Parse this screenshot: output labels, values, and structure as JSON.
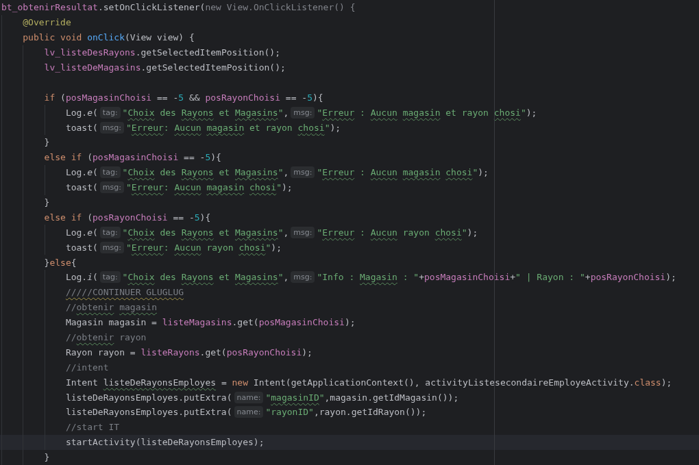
{
  "lines": [
    {
      "current": false,
      "tokens": [
        {
          "text": "bt_obtenirResultat",
          "kind": "field"
        },
        {
          "text": ".setOnClickListener(",
          "kind": "plain"
        },
        {
          "text": "new View.OnClickListener() {",
          "kind": "faded"
        }
      ],
      "children": [
        {
          "current": false,
          "tokens": [
            {
              "text": "@Override",
              "kind": "annotation"
            }
          ]
        },
        {
          "current": false,
          "tokens": [
            {
              "text": "public void ",
              "kind": "keyword"
            },
            {
              "text": "onClick",
              "kind": "method"
            },
            {
              "text": "(View view) {",
              "kind": "plain"
            }
          ],
          "children": [
            {
              "current": false,
              "tokens": [
                {
                  "text": "lv_listeDesRayons",
                  "kind": "field"
                },
                {
                  "text": ".getSelectedItemPosition();",
                  "kind": "plain"
                }
              ]
            },
            {
              "current": false,
              "tokens": [
                {
                  "text": "lv_listeDeMagasins",
                  "kind": "field"
                },
                {
                  "text": ".getSelectedItemPosition();",
                  "kind": "plain"
                }
              ]
            },
            {
              "current": false
            },
            {
              "current": false,
              "tokens": [
                {
                  "text": "if ",
                  "kind": "keyword"
                },
                {
                  "text": "(",
                  "kind": "plain"
                },
                {
                  "text": "posMagasinChoisi",
                  "kind": "field"
                },
                {
                  "text": " == -",
                  "kind": "plain"
                },
                {
                  "text": "5",
                  "kind": "number"
                },
                {
                  "text": " && ",
                  "kind": "plain"
                },
                {
                  "text": "posRayonChoisi",
                  "kind": "field"
                },
                {
                  "text": " == -",
                  "kind": "plain"
                },
                {
                  "text": "5",
                  "kind": "number"
                },
                {
                  "text": "){",
                  "kind": "plain"
                }
              ],
              "children": [
                {
                  "current": false,
                  "tokens": [
                    {
                      "text": "Log.",
                      "kind": "plain"
                    },
                    {
                      "text": "e",
                      "kind": "static"
                    },
                    {
                      "text": "(",
                      "kind": "plain"
                    },
                    {
                      "text": "tag:",
                      "kind": "hint"
                    },
                    {
                      "text": "\"",
                      "kind": "string"
                    },
                    {
                      "text": "Choix",
                      "kind": "string",
                      "misspelled": true
                    },
                    {
                      "text": " des",
                      "kind": "string"
                    },
                    {
                      "text": " Rayons",
                      "kind": "string",
                      "misspelled": true
                    },
                    {
                      "text": " et",
                      "kind": "string"
                    },
                    {
                      "text": " Magasins",
                      "kind": "string",
                      "misspelled": true
                    },
                    {
                      "text": "\"",
                      "kind": "string"
                    },
                    {
                      "text": ",",
                      "kind": "plain"
                    },
                    {
                      "text": "msg:",
                      "kind": "hint"
                    },
                    {
                      "text": "\"",
                      "kind": "string"
                    },
                    {
                      "text": "Erreur",
                      "kind": "string",
                      "misspelled": true
                    },
                    {
                      "text": " :",
                      "kind": "string"
                    },
                    {
                      "text": " Aucun",
                      "kind": "string",
                      "misspelled": true
                    },
                    {
                      "text": " magasin",
                      "kind": "string",
                      "misspelled": true
                    },
                    {
                      "text": " et rayon",
                      "kind": "string"
                    },
                    {
                      "text": " chosi",
                      "kind": "string",
                      "misspelled": true
                    },
                    {
                      "text": "\"",
                      "kind": "string"
                    },
                    {
                      "text": ");",
                      "kind": "plain"
                    }
                  ]
                },
                {
                  "current": false,
                  "tokens": [
                    {
                      "text": "toast(",
                      "kind": "plain"
                    },
                    {
                      "text": "msg:",
                      "kind": "hint"
                    },
                    {
                      "text": "\"",
                      "kind": "string"
                    },
                    {
                      "text": "Erreur",
                      "kind": "string",
                      "misspelled": true
                    },
                    {
                      "text": ":",
                      "kind": "string"
                    },
                    {
                      "text": " Aucun",
                      "kind": "string",
                      "misspelled": true
                    },
                    {
                      "text": " magasin",
                      "kind": "string",
                      "misspelled": true
                    },
                    {
                      "text": " et rayon",
                      "kind": "string"
                    },
                    {
                      "text": " chosi",
                      "kind": "string",
                      "misspelled": true
                    },
                    {
                      "text": "\"",
                      "kind": "string"
                    },
                    {
                      "text": ");",
                      "kind": "plain"
                    }
                  ]
                }
              ]
            },
            {
              "current": false,
              "tokens": [
                {
                  "text": "}",
                  "kind": "plain"
                }
              ]
            },
            {
              "current": false,
              "tokens": [
                {
                  "text": "else if ",
                  "kind": "keyword"
                },
                {
                  "text": "(",
                  "kind": "plain"
                },
                {
                  "text": "posMagasinChoisi",
                  "kind": "field"
                },
                {
                  "text": " == -",
                  "kind": "plain"
                },
                {
                  "text": "5",
                  "kind": "number"
                },
                {
                  "text": "){",
                  "kind": "plain"
                }
              ],
              "children": [
                {
                  "current": false,
                  "tokens": [
                    {
                      "text": "Log.",
                      "kind": "plain"
                    },
                    {
                      "text": "e",
                      "kind": "static"
                    },
                    {
                      "text": "(",
                      "kind": "plain"
                    },
                    {
                      "text": "tag:",
                      "kind": "hint"
                    },
                    {
                      "text": "\"",
                      "kind": "string"
                    },
                    {
                      "text": "Choix",
                      "kind": "string",
                      "misspelled": true
                    },
                    {
                      "text": " des",
                      "kind": "string"
                    },
                    {
                      "text": " Rayons",
                      "kind": "string",
                      "misspelled": true
                    },
                    {
                      "text": " et",
                      "kind": "string"
                    },
                    {
                      "text": " Magasins",
                      "kind": "string",
                      "misspelled": true
                    },
                    {
                      "text": "\"",
                      "kind": "string"
                    },
                    {
                      "text": ",",
                      "kind": "plain"
                    },
                    {
                      "text": "msg:",
                      "kind": "hint"
                    },
                    {
                      "text": "\"",
                      "kind": "string"
                    },
                    {
                      "text": "Erreur",
                      "kind": "string",
                      "misspelled": true
                    },
                    {
                      "text": " :",
                      "kind": "string"
                    },
                    {
                      "text": " Aucun",
                      "kind": "string",
                      "misspelled": true
                    },
                    {
                      "text": " magasin",
                      "kind": "string",
                      "misspelled": true
                    },
                    {
                      "text": " chosi",
                      "kind": "string",
                      "misspelled": true
                    },
                    {
                      "text": "\"",
                      "kind": "string"
                    },
                    {
                      "text": ");",
                      "kind": "plain"
                    }
                  ]
                },
                {
                  "current": false,
                  "tokens": [
                    {
                      "text": "toast(",
                      "kind": "plain"
                    },
                    {
                      "text": "msg:",
                      "kind": "hint"
                    },
                    {
                      "text": "\"",
                      "kind": "string"
                    },
                    {
                      "text": "Erreur",
                      "kind": "string",
                      "misspelled": true
                    },
                    {
                      "text": ":",
                      "kind": "string"
                    },
                    {
                      "text": " Aucun",
                      "kind": "string",
                      "misspelled": true
                    },
                    {
                      "text": " magasin",
                      "kind": "string",
                      "misspelled": true
                    },
                    {
                      "text": " chosi",
                      "kind": "string",
                      "misspelled": true
                    },
                    {
                      "text": "\"",
                      "kind": "string"
                    },
                    {
                      "text": ");",
                      "kind": "plain"
                    }
                  ]
                }
              ]
            },
            {
              "current": false,
              "tokens": [
                {
                  "text": "}",
                  "kind": "plain"
                }
              ]
            },
            {
              "current": false,
              "tokens": [
                {
                  "text": "else if ",
                  "kind": "keyword"
                },
                {
                  "text": "(",
                  "kind": "plain"
                },
                {
                  "text": "posRayonChoisi",
                  "kind": "field"
                },
                {
                  "text": " == -",
                  "kind": "plain"
                },
                {
                  "text": "5",
                  "kind": "number"
                },
                {
                  "text": "){",
                  "kind": "plain"
                }
              ],
              "children": [
                {
                  "current": false,
                  "tokens": [
                    {
                      "text": "Log.",
                      "kind": "plain"
                    },
                    {
                      "text": "e",
                      "kind": "static"
                    },
                    {
                      "text": "(",
                      "kind": "plain"
                    },
                    {
                      "text": "tag:",
                      "kind": "hint"
                    },
                    {
                      "text": "\"",
                      "kind": "string"
                    },
                    {
                      "text": "Choix",
                      "kind": "string",
                      "misspelled": true
                    },
                    {
                      "text": " des",
                      "kind": "string"
                    },
                    {
                      "text": " Rayons",
                      "kind": "string",
                      "misspelled": true
                    },
                    {
                      "text": " et",
                      "kind": "string"
                    },
                    {
                      "text": " Magasins",
                      "kind": "string",
                      "misspelled": true
                    },
                    {
                      "text": "\"",
                      "kind": "string"
                    },
                    {
                      "text": ",",
                      "kind": "plain"
                    },
                    {
                      "text": "msg:",
                      "kind": "hint"
                    },
                    {
                      "text": "\"",
                      "kind": "string"
                    },
                    {
                      "text": "Erreur",
                      "kind": "string",
                      "misspelled": true
                    },
                    {
                      "text": " :",
                      "kind": "string"
                    },
                    {
                      "text": " Aucun",
                      "kind": "string",
                      "misspelled": true
                    },
                    {
                      "text": " rayon",
                      "kind": "string"
                    },
                    {
                      "text": " chosi",
                      "kind": "string",
                      "misspelled": true
                    },
                    {
                      "text": "\"",
                      "kind": "string"
                    },
                    {
                      "text": ");",
                      "kind": "plain"
                    }
                  ]
                },
                {
                  "current": false,
                  "tokens": [
                    {
                      "text": "toast(",
                      "kind": "plain"
                    },
                    {
                      "text": "msg:",
                      "kind": "hint"
                    },
                    {
                      "text": "\"",
                      "kind": "string"
                    },
                    {
                      "text": "Erreur",
                      "kind": "string",
                      "misspelled": true
                    },
                    {
                      "text": ":",
                      "kind": "string"
                    },
                    {
                      "text": " Aucun",
                      "kind": "string",
                      "misspelled": true
                    },
                    {
                      "text": " rayon",
                      "kind": "string"
                    },
                    {
                      "text": " chosi",
                      "kind": "string",
                      "misspelled": true
                    },
                    {
                      "text": "\"",
                      "kind": "string"
                    },
                    {
                      "text": ");",
                      "kind": "plain"
                    }
                  ]
                }
              ]
            },
            {
              "current": false,
              "tokens": [
                {
                  "text": "}",
                  "kind": "plain"
                },
                {
                  "text": "else",
                  "kind": "keyword"
                },
                {
                  "text": "{",
                  "kind": "plain"
                }
              ],
              "children": [
                {
                  "current": false,
                  "tokens": [
                    {
                      "text": "Log.",
                      "kind": "plain"
                    },
                    {
                      "text": "i",
                      "kind": "static"
                    },
                    {
                      "text": "(",
                      "kind": "plain"
                    },
                    {
                      "text": "tag:",
                      "kind": "hint"
                    },
                    {
                      "text": "\"",
                      "kind": "string"
                    },
                    {
                      "text": "Choix",
                      "kind": "string",
                      "misspelled": true
                    },
                    {
                      "text": " des",
                      "kind": "string"
                    },
                    {
                      "text": " Rayons",
                      "kind": "string",
                      "misspelled": true
                    },
                    {
                      "text": " et",
                      "kind": "string"
                    },
                    {
                      "text": " Magasins",
                      "kind": "string",
                      "misspelled": true
                    },
                    {
                      "text": "\"",
                      "kind": "string"
                    },
                    {
                      "text": ",",
                      "kind": "plain"
                    },
                    {
                      "text": "msg:",
                      "kind": "hint"
                    },
                    {
                      "text": "\"Info :",
                      "kind": "string"
                    },
                    {
                      "text": " Magasin",
                      "kind": "string",
                      "misspelled": true
                    },
                    {
                      "text": " : \"",
                      "kind": "string"
                    },
                    {
                      "text": "+",
                      "kind": "plain"
                    },
                    {
                      "text": "posMagasinChoisi",
                      "kind": "field"
                    },
                    {
                      "text": "+",
                      "kind": "plain"
                    },
                    {
                      "text": "\" | Rayon : \"",
                      "kind": "string"
                    },
                    {
                      "text": "+",
                      "kind": "plain"
                    },
                    {
                      "text": "posRayonChoisi",
                      "kind": "field"
                    },
                    {
                      "text": ");",
                      "kind": "plain"
                    }
                  ]
                },
                {
                  "current": false,
                  "tokens": [
                    {
                      "text": "/////CONTINUER GLUGLUG",
                      "kind": "comment",
                      "warning": true
                    }
                  ]
                },
                {
                  "current": false,
                  "tokens": [
                    {
                      "text": "//",
                      "kind": "comment"
                    },
                    {
                      "text": "obtenir",
                      "kind": "comment",
                      "misspelled": true
                    },
                    {
                      "text": " magasin",
                      "kind": "comment",
                      "misspelled": true
                    }
                  ]
                },
                {
                  "current": false,
                  "tokens": [
                    {
                      "text": "Magasin magasin = ",
                      "kind": "plain"
                    },
                    {
                      "text": "listeMagasins",
                      "kind": "field"
                    },
                    {
                      "text": ".get(",
                      "kind": "plain"
                    },
                    {
                      "text": "posMagasinChoisi",
                      "kind": "field"
                    },
                    {
                      "text": ");",
                      "kind": "plain"
                    }
                  ]
                },
                {
                  "current": false,
                  "tokens": [
                    {
                      "text": "//",
                      "kind": "comment"
                    },
                    {
                      "text": "obtenir",
                      "kind": "comment",
                      "misspelled": true
                    },
                    {
                      "text": " rayon",
                      "kind": "comment"
                    }
                  ]
                },
                {
                  "current": false,
                  "tokens": [
                    {
                      "text": "Rayon rayon = ",
                      "kind": "plain"
                    },
                    {
                      "text": "listeRayons",
                      "kind": "field"
                    },
                    {
                      "text": ".get(",
                      "kind": "plain"
                    },
                    {
                      "text": "posRayonChoisi",
                      "kind": "field"
                    },
                    {
                      "text": ");",
                      "kind": "plain"
                    }
                  ]
                },
                {
                  "current": false,
                  "tokens": [
                    {
                      "text": "//intent",
                      "kind": "comment"
                    }
                  ]
                },
                {
                  "current": false,
                  "tokens": [
                    {
                      "text": "Intent",
                      "kind": "plain"
                    },
                    {
                      "text": " listeDeRayonsEmployes",
                      "kind": "plain",
                      "misspelled": true
                    },
                    {
                      "text": " = ",
                      "kind": "plain"
                    },
                    {
                      "text": "new ",
                      "kind": "keyword"
                    },
                    {
                      "text": "Intent(getApplicationContext(), activityListesecondaireEmployeActivity.",
                      "kind": "plain"
                    },
                    {
                      "text": "class",
                      "kind": "keyword"
                    },
                    {
                      "text": ");",
                      "kind": "plain"
                    }
                  ]
                },
                {
                  "current": false,
                  "tokens": [
                    {
                      "text": "listeDeRayonsEmployes.putExtra(",
                      "kind": "plain"
                    },
                    {
                      "text": "name:",
                      "kind": "hint"
                    },
                    {
                      "text": "\"",
                      "kind": "string"
                    },
                    {
                      "text": "magasinID",
                      "kind": "string",
                      "misspelled": true
                    },
                    {
                      "text": "\"",
                      "kind": "string"
                    },
                    {
                      "text": ",magasin.getIdMagasin());",
                      "kind": "plain"
                    }
                  ]
                },
                {
                  "current": false,
                  "tokens": [
                    {
                      "text": "listeDeRayonsEmployes.putExtra(",
                      "kind": "plain"
                    },
                    {
                      "text": "name:",
                      "kind": "hint"
                    },
                    {
                      "text": "\"rayonID\"",
                      "kind": "string"
                    },
                    {
                      "text": ",rayon.getIdRayon());",
                      "kind": "plain"
                    }
                  ]
                },
                {
                  "current": false,
                  "tokens": [
                    {
                      "text": "//start IT",
                      "kind": "comment"
                    }
                  ]
                },
                {
                  "current": true,
                  "tokens": [
                    {
                      "text": "startActivity(listeDeRayonsEmployes);",
                      "kind": "plain"
                    }
                  ]
                }
              ]
            },
            {
              "current": false,
              "tokens": [
                {
                  "text": "}",
                  "kind": "plain"
                }
              ]
            }
          ]
        }
      ]
    }
  ]
}
